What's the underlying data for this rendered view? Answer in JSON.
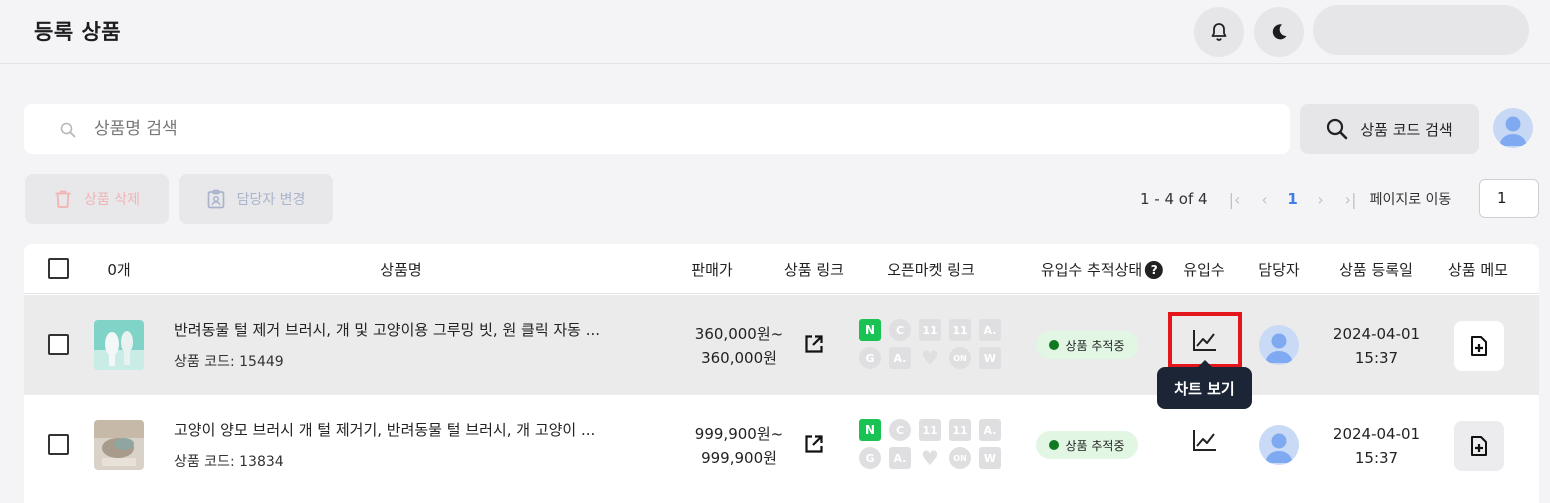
{
  "header": {
    "title": "등록 상품"
  },
  "search": {
    "placeholder": "상품명 검색",
    "code_search_label": "상품 코드 검색"
  },
  "actions": {
    "delete_label": "상품 삭제",
    "assign_label": "담당자 변경"
  },
  "pagination": {
    "info": "1 - 4 of 4",
    "current_page": "1",
    "goto_label": "페이지로 이동",
    "goto_value": "1"
  },
  "table": {
    "headers": {
      "count": "0개",
      "name": "상품명",
      "price": "판매가",
      "link": "상품 링크",
      "openmarket": "오픈마켓 링크",
      "tracking": "유입수 추적상태",
      "tracking_help": "?",
      "inflow": "유입수",
      "manager": "담당자",
      "reg_date": "상품 등록일",
      "memo": "상품 메모"
    },
    "market_marks": [
      "N",
      "C",
      "11",
      "11",
      "A.",
      "G",
      "A.",
      "♥",
      "ON",
      "W"
    ],
    "rows": [
      {
        "name": "반려동물 털 제거 브러시, 개 및 고양이용 그루밍 빗, 원 클릭 자동 ...",
        "code": "상품 코드: 15449",
        "price_min": "360,000원~",
        "price_max": "360,000원",
        "tracking": "상품 추적중",
        "reg_date": "2024-04-01",
        "reg_time": "15:37"
      },
      {
        "name": "고양이 양모 브러시 개 털 제거기, 반려동물 털 브러시, 개 고양이 ...",
        "code": "상품 코드: 13834",
        "price_min": "999,900원~",
        "price_max": "999,900원",
        "tracking": "상품 추적중",
        "reg_date": "2024-04-01",
        "reg_time": "15:37"
      }
    ]
  },
  "tooltip": {
    "text": "차트 보기"
  },
  "colors": {
    "accent": "#3f7ee8",
    "highlight": "#e5161b",
    "naver": "#19c253",
    "tracking_dot": "#0f7a21",
    "tooltip_bg": "#1c2535"
  }
}
